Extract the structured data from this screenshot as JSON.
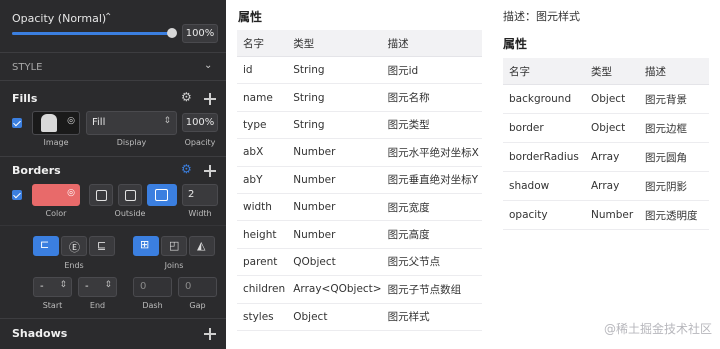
{
  "inspector": {
    "opacity_label": "Opacity (Normal)",
    "opacity_value": "100%",
    "opacity_level": 1.0,
    "style_label": "STYLE",
    "fills": {
      "title": "Fills",
      "fill_type": "Fill",
      "opacity": "100%",
      "labels": {
        "image": "Image",
        "display": "Display",
        "opacity": "Opacity"
      }
    },
    "borders": {
      "title": "Borders",
      "width": "2",
      "labels": {
        "color": "Color",
        "outside": "Outside",
        "width": "Width"
      },
      "color": "#e86a6a"
    },
    "ends_label": "Ends",
    "joins_label": "Joins",
    "start_value": "-",
    "end_value": "-",
    "dash_value": "0",
    "gap_value": "0",
    "labels": {
      "start": "Start",
      "end": "End",
      "dash": "Dash",
      "gap": "Gap"
    },
    "shadows_title": "Shadows",
    "accent": "#3b7fe0"
  },
  "table_left": {
    "title": "属性",
    "headers": [
      "名字",
      "类型",
      "描述"
    ],
    "rows": [
      [
        "id",
        "String",
        "图元id"
      ],
      [
        "name",
        "String",
        "图元名称"
      ],
      [
        "type",
        "String",
        "图元类型"
      ],
      [
        "abX",
        "Number",
        "图元水平绝对坐标X"
      ],
      [
        "abY",
        "Number",
        "图元垂直绝对坐标Y"
      ],
      [
        "width",
        "Number",
        "图元宽度"
      ],
      [
        "height",
        "Number",
        "图元高度"
      ],
      [
        "parent",
        "QObject",
        "图元父节点"
      ],
      [
        "children",
        "Array<QObject>",
        "图元子节点数组"
      ],
      [
        "styles",
        "Object",
        "图元样式"
      ]
    ]
  },
  "table_right": {
    "caption": "描述：图元样式",
    "title": "属性",
    "headers": [
      "名字",
      "类型",
      "描述"
    ],
    "rows": [
      [
        "background",
        "Object",
        "图元背景"
      ],
      [
        "border",
        "Object",
        "图元边框"
      ],
      [
        "borderRadius",
        "Array",
        "图元圆角"
      ],
      [
        "shadow",
        "Array",
        "图元阴影"
      ],
      [
        "opacity",
        "Number",
        "图元透明度"
      ]
    ]
  },
  "watermark": "@稀土掘金技术社区"
}
